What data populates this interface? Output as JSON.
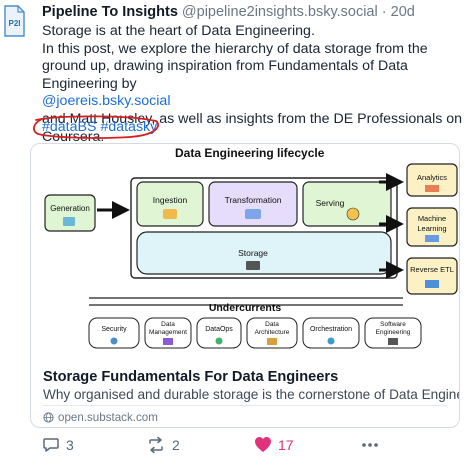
{
  "post": {
    "avatar_text": "P2I",
    "author_name": "Pipeline To Insights",
    "author_handle": "@pipeline2insights.bsky.social",
    "separator": "·",
    "time_ago": "20d",
    "line1": "Storage is at the heart of Data Engineering.",
    "line2": "In this post, we explore the hierarchy of data storage from the ground up, drawing inspiration from Fundamentals of Data Engineering by",
    "mention": "@joereis.bsky.social",
    "line3": "and Matt Housley, as well as insights from the DE Professionals on Coursera.",
    "hashtags": [
      "#dataBS",
      "#datasky"
    ]
  },
  "card": {
    "diagram": {
      "title": "Data Engineering lifecycle",
      "generation": "Generation",
      "ingestion": "Ingestion",
      "transformation": "Transformation",
      "serving": "Serving",
      "storage": "Storage",
      "analytics": "Analytics",
      "ml_line1": "Machine",
      "ml_line2": "Learning",
      "reverse_etl": "Reverse ETL",
      "undercurrents": "Undercurrents",
      "security": "Security",
      "data_mgmt_1": "Data",
      "data_mgmt_2": "Management",
      "dataops": "DataOps",
      "data_arch_1": "Data",
      "data_arch_2": "Architecture",
      "orchestration": "Orchestration",
      "software_1": "Software",
      "software_2": "Engineering"
    },
    "title": "Storage Fundamentals For Data Engineers",
    "description": "Why organised and durable storage is the cornerstone of Data Engineering?",
    "domain": "open.substack.com"
  },
  "actions": {
    "replies": "3",
    "reposts": "2",
    "likes": "17"
  },
  "colors": {
    "link": "#1d6fd6",
    "like": "#e0317a",
    "green_box": "#dff5d4",
    "purple_box": "#e6dcfb",
    "yellow_box": "#fbf1c4",
    "cyan_box": "#dff4f8"
  },
  "icons": [
    "avatar-logo-icon",
    "reply-icon",
    "repost-icon",
    "like-heart-icon",
    "more-icon",
    "globe-icon"
  ]
}
